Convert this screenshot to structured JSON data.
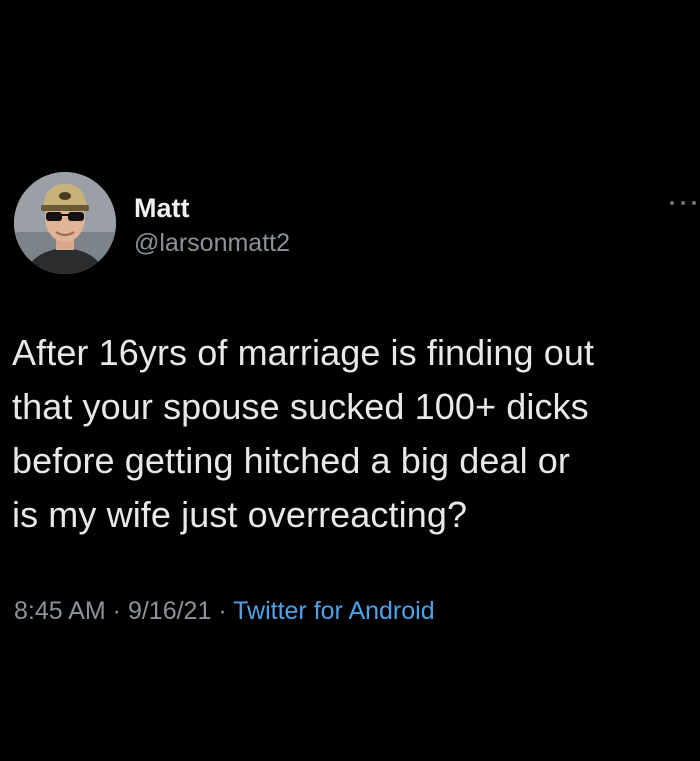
{
  "user": {
    "display_name": "Matt",
    "handle": "@larsonmatt2"
  },
  "tweet": {
    "text": "After 16yrs of marriage is finding out\nthat your spouse sucked 100+ dicks\nbefore getting hitched a big deal or\nis my wife just overreacting?",
    "time": "8:45 AM",
    "separator": " · ",
    "date": "9/16/21",
    "source": "Twitter for Android"
  },
  "icons": {
    "more": "more-horizontal-icon",
    "avatar": "profile-photo"
  },
  "colors": {
    "background": "#000000",
    "text": "#e8e8e8",
    "secondary": "#8b9299",
    "link": "#4ea2e8"
  }
}
